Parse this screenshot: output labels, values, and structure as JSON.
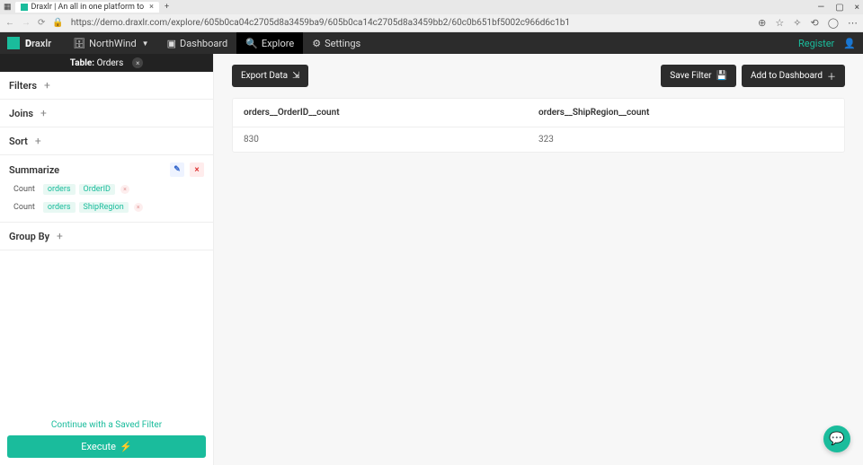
{
  "browser": {
    "tab_title": "Draxlr | An all in one platform to",
    "url": "https://demo.draxlr.com/explore/605b0ca04c2705d8a3459ba9/605b0ca14c2705d8a3459bb2/60c0b651bf5002c966d6c1b1"
  },
  "nav": {
    "brand_d": "D",
    "brand_rest": "raxlr",
    "workspace": "NorthWind",
    "items": {
      "dashboard": "Dashboard",
      "explore": "Explore",
      "settings": "Settings"
    },
    "register": "Register"
  },
  "sidebar": {
    "table_label": "Table:",
    "table_name": "Orders",
    "filters": "Filters",
    "joins": "Joins",
    "sort": "Sort",
    "summarize": "Summarize",
    "groupby": "Group By",
    "summ_rows": [
      {
        "agg": "Count",
        "table": "orders",
        "field": "OrderID"
      },
      {
        "agg": "Count",
        "table": "orders",
        "field": "ShipRegion"
      }
    ],
    "saved_filter": "Continue with a Saved Filter",
    "execute": "Execute"
  },
  "toolbar": {
    "export": "Export Data",
    "save_filter": "Save Filter",
    "add_dash": "Add to Dashboard"
  },
  "table": {
    "headers": [
      "orders__OrderID__count",
      "orders__ShipRegion__count"
    ],
    "rows": [
      [
        "830",
        "323"
      ]
    ]
  }
}
